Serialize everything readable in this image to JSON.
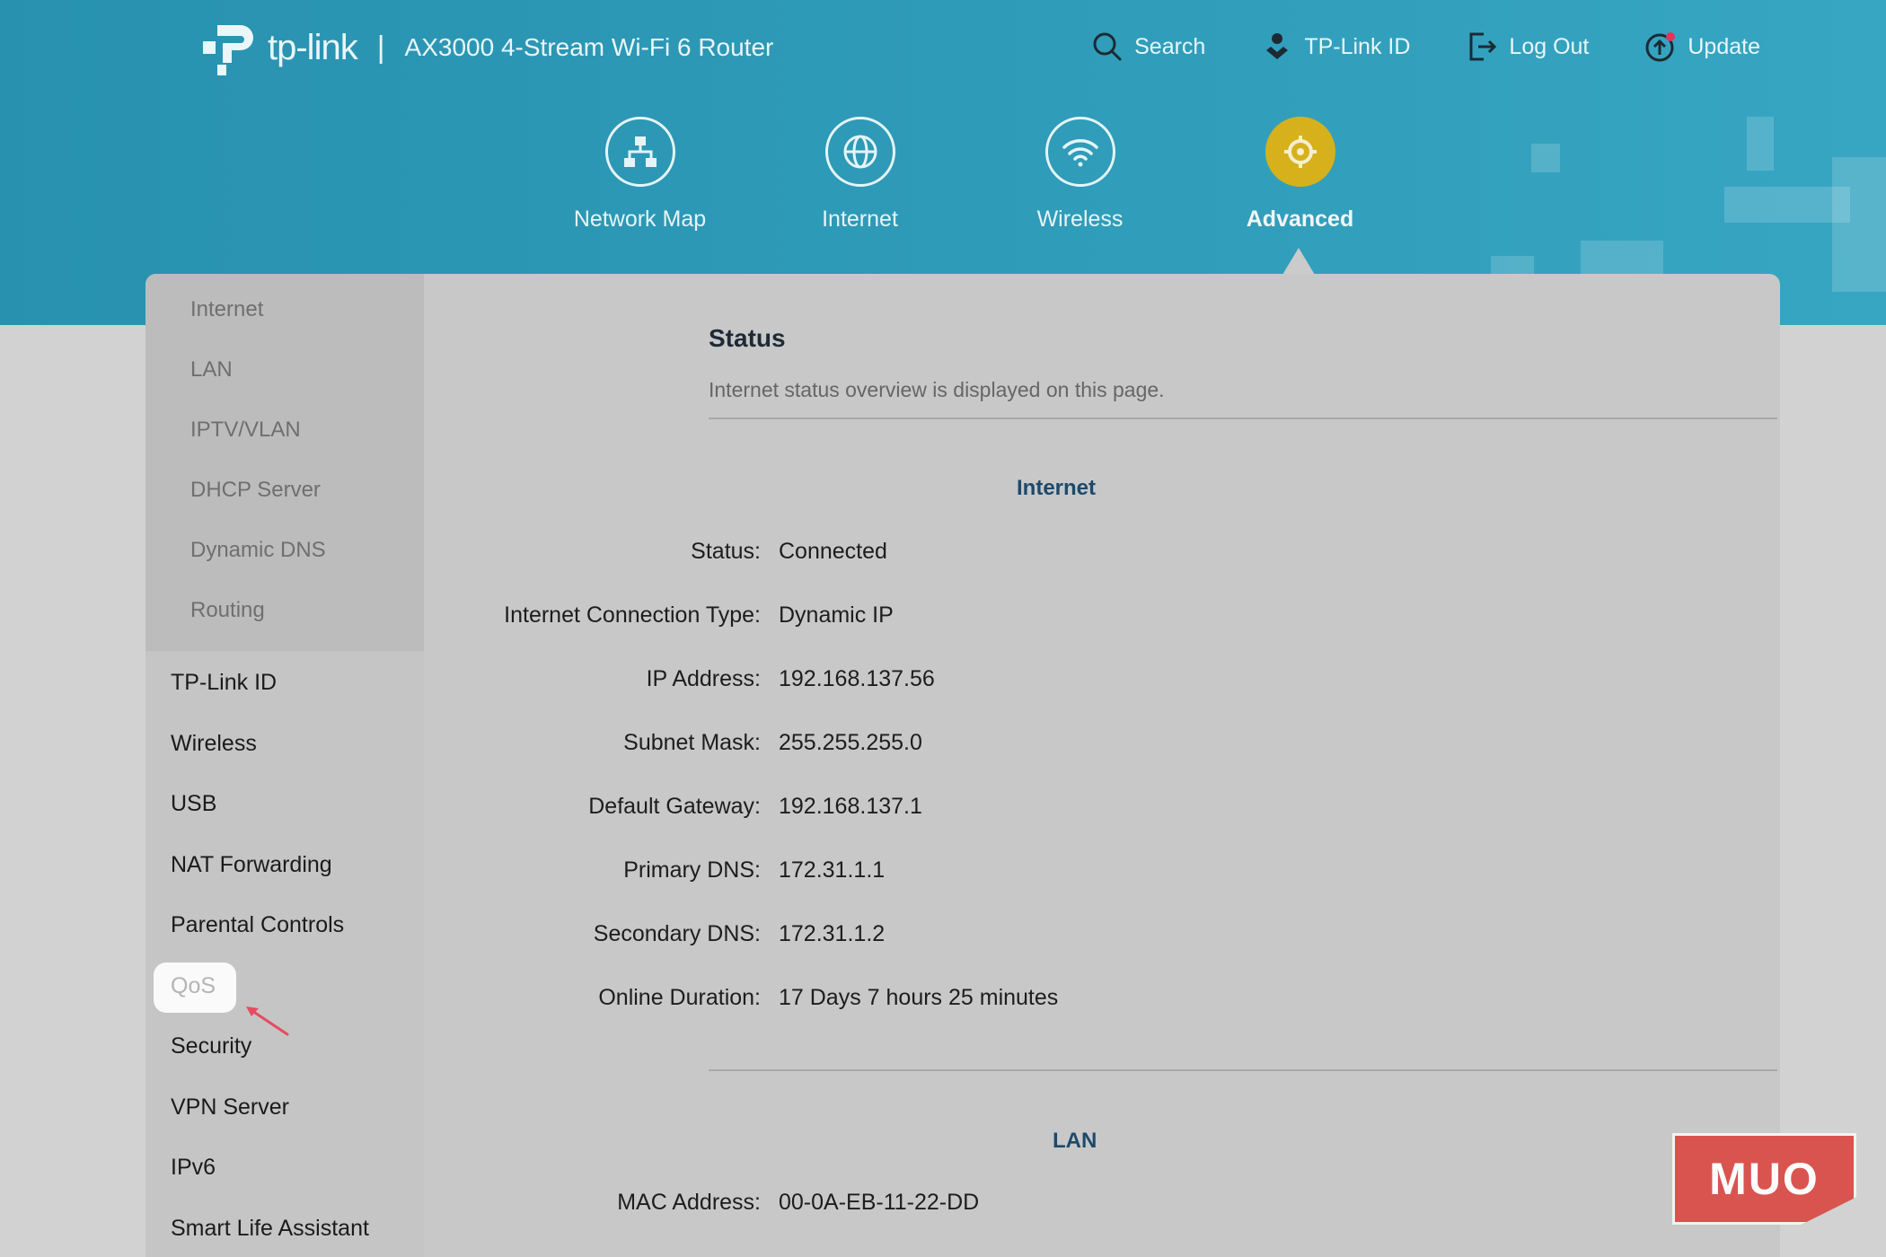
{
  "header": {
    "logo_text": "tp-link",
    "separator": "|",
    "model": "AX3000 4-Stream Wi-Fi 6 Router",
    "links": [
      {
        "label": "Search",
        "icon": "search-icon"
      },
      {
        "label": "TP-Link ID",
        "icon": "tplink-id-icon"
      },
      {
        "label": "Log Out",
        "icon": "logout-icon"
      },
      {
        "label": "Update",
        "icon": "update-icon"
      }
    ],
    "nav": [
      {
        "label": "Network Map",
        "icon": "network-map-icon"
      },
      {
        "label": "Internet",
        "icon": "globe-icon"
      },
      {
        "label": "Wireless",
        "icon": "wifi-icon"
      },
      {
        "label": "Advanced",
        "icon": "gear-icon",
        "active": true
      }
    ]
  },
  "sidebar": {
    "submenu": [
      "Internet",
      "LAN",
      "IPTV/VLAN",
      "DHCP Server",
      "Dynamic DNS",
      "Routing"
    ],
    "menu": [
      "TP-Link ID",
      "Wireless",
      "USB",
      "NAT Forwarding",
      "Parental Controls",
      "QoS",
      "Security",
      "VPN Server",
      "IPv6",
      "Smart Life Assistant"
    ],
    "highlighted": "QoS"
  },
  "content": {
    "title": "Status",
    "description": "Internet status overview is displayed on this page.",
    "internet": {
      "title": "Internet",
      "rows": [
        {
          "label": "Status:",
          "value": "Connected"
        },
        {
          "label": "Internet Connection Type:",
          "value": "Dynamic IP"
        },
        {
          "label": "IP Address:",
          "value": "192.168.137.56"
        },
        {
          "label": "Subnet Mask:",
          "value": "255.255.255.0"
        },
        {
          "label": "Default Gateway:",
          "value": "192.168.137.1"
        },
        {
          "label": "Primary DNS:",
          "value": "172.31.1.1"
        },
        {
          "label": "Secondary DNS:",
          "value": "172.31.1.2"
        },
        {
          "label": "Online Duration:",
          "value": "17 Days 7 hours 25 minutes"
        }
      ]
    },
    "lan": {
      "title": "LAN",
      "rows": [
        {
          "label": "MAC Address:",
          "value": "00-0A-EB-11-22-DD"
        }
      ]
    }
  },
  "watermark": "MUO",
  "colors": {
    "header_bg": "#2e9bb8",
    "active_nav": "#d6b11b",
    "section_title": "#1d4a6a",
    "annotation_arrow": "#e84a5f",
    "watermark_bg": "#d9544f"
  }
}
